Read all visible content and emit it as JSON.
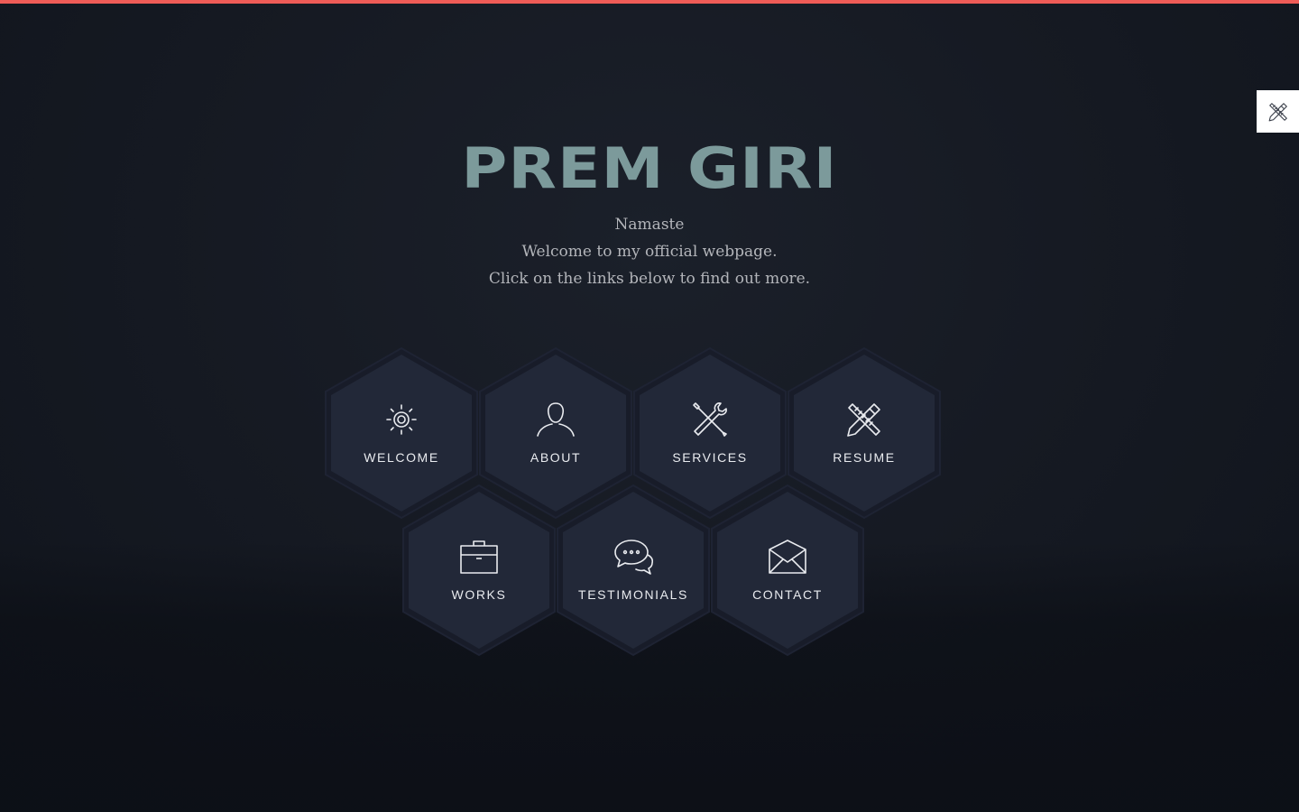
{
  "hero": {
    "title": "PREM GIRI",
    "lines": [
      "Namaste",
      "Welcome to my official webpage.",
      "Click on the links below to find out more."
    ]
  },
  "nav": [
    {
      "label": "WELCOME",
      "icon": "sun-icon"
    },
    {
      "label": "ABOUT",
      "icon": "user-icon"
    },
    {
      "label": "SERVICES",
      "icon": "tools-icon"
    },
    {
      "label": "RESUME",
      "icon": "pencil-ruler-icon"
    },
    {
      "label": "WORKS",
      "icon": "briefcase-icon"
    },
    {
      "label": "TESTIMONIALS",
      "icon": "chat-bubbles-icon"
    },
    {
      "label": "CONTACT",
      "icon": "envelope-icon"
    }
  ],
  "side_tool": {
    "icon": "pencil-ruler-icon"
  },
  "colors": {
    "accent": "#ef5c57",
    "title": "#7c9a9b",
    "hex_fill": "#222838",
    "hex_border": "#1b2030",
    "text_muted": "#b3b5ba"
  }
}
